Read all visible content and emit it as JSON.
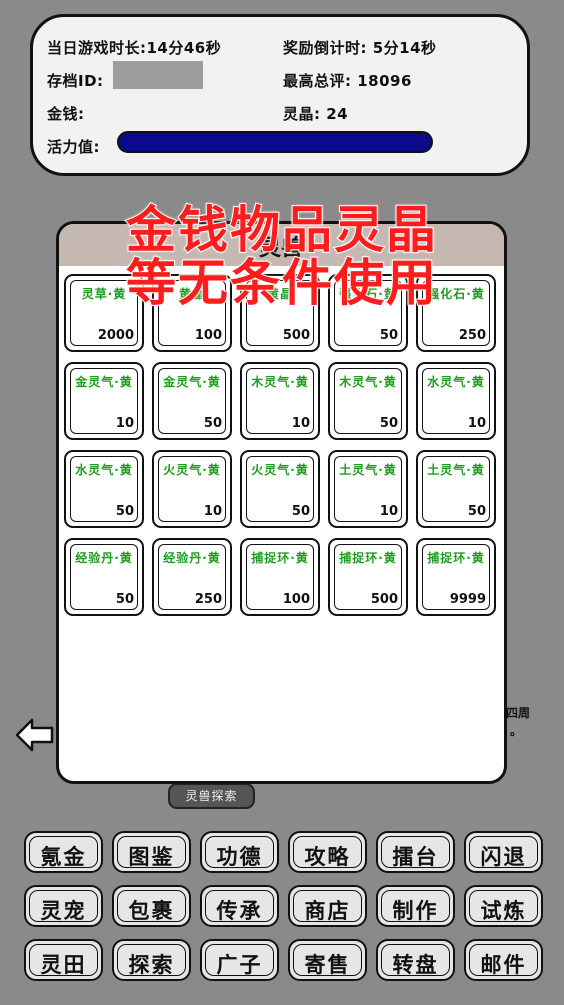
{
  "status": {
    "playtime": "当日游戏时长:14分46秒",
    "reward_countdown": "奖励倒计时: 5分14秒",
    "save_id_label": "存档ID:",
    "high_score": "最高总评: 18096",
    "money_label": "金钱:",
    "crystal": "灵晶: 24",
    "vitality_label": "活力值:",
    "vitality_fill": 1.0
  },
  "background": {
    "note_right": "四周",
    "note_dot": "。",
    "explore_tab": "灵兽探索"
  },
  "modal": {
    "title": "灵兽",
    "items": [
      {
        "name": "灵草·黄",
        "count": "2000"
      },
      {
        "name": "黄晶",
        "count": "100"
      },
      {
        "name": "黄晶",
        "count": "500"
      },
      {
        "name": "强化石·黄",
        "count": "50"
      },
      {
        "name": "强化石·黄",
        "count": "250"
      },
      {
        "name": "金灵气·黄",
        "count": "10"
      },
      {
        "name": "金灵气·黄",
        "count": "50"
      },
      {
        "name": "木灵气·黄",
        "count": "10"
      },
      {
        "name": "木灵气·黄",
        "count": "50"
      },
      {
        "name": "水灵气·黄",
        "count": "10"
      },
      {
        "name": "水灵气·黄",
        "count": "50"
      },
      {
        "name": "火灵气·黄",
        "count": "10"
      },
      {
        "name": "火灵气·黄",
        "count": "50"
      },
      {
        "name": "土灵气·黄",
        "count": "10"
      },
      {
        "name": "土灵气·黄",
        "count": "50"
      },
      {
        "name": "经验丹·黄",
        "count": "50"
      },
      {
        "name": "经验丹·黄",
        "count": "250"
      },
      {
        "name": "捕捉环·黄",
        "count": "100"
      },
      {
        "name": "捕捉环·黄",
        "count": "500"
      },
      {
        "name": "捕捉环·黄",
        "count": "9999"
      }
    ]
  },
  "menu": [
    {
      "label": "氪金",
      "id": "recharge"
    },
    {
      "label": "图鉴",
      "id": "codex"
    },
    {
      "label": "功德",
      "id": "merit"
    },
    {
      "label": "攻略",
      "id": "guide"
    },
    {
      "label": "擂台",
      "id": "arena"
    },
    {
      "label": "闪退",
      "id": "exit"
    },
    {
      "label": "灵宠",
      "id": "pet"
    },
    {
      "label": "包裹",
      "id": "bag"
    },
    {
      "label": "传承",
      "id": "inherit"
    },
    {
      "label": "商店",
      "id": "shop"
    },
    {
      "label": "制作",
      "id": "craft"
    },
    {
      "label": "试炼",
      "id": "trial"
    },
    {
      "label": "灵田",
      "id": "field"
    },
    {
      "label": "探索",
      "id": "explore"
    },
    {
      "label": "广子",
      "id": "ads"
    },
    {
      "label": "寄售",
      "id": "consign"
    },
    {
      "label": "转盘",
      "id": "wheel"
    },
    {
      "label": "邮件",
      "id": "mail"
    }
  ],
  "overlay": {
    "line1": "金钱物品灵晶",
    "line2": "等无条件使用"
  },
  "colors": {
    "item_name": "#1d9e1d",
    "vitality": "#0a0a8a",
    "overlay_text": "#ff1c1c"
  }
}
